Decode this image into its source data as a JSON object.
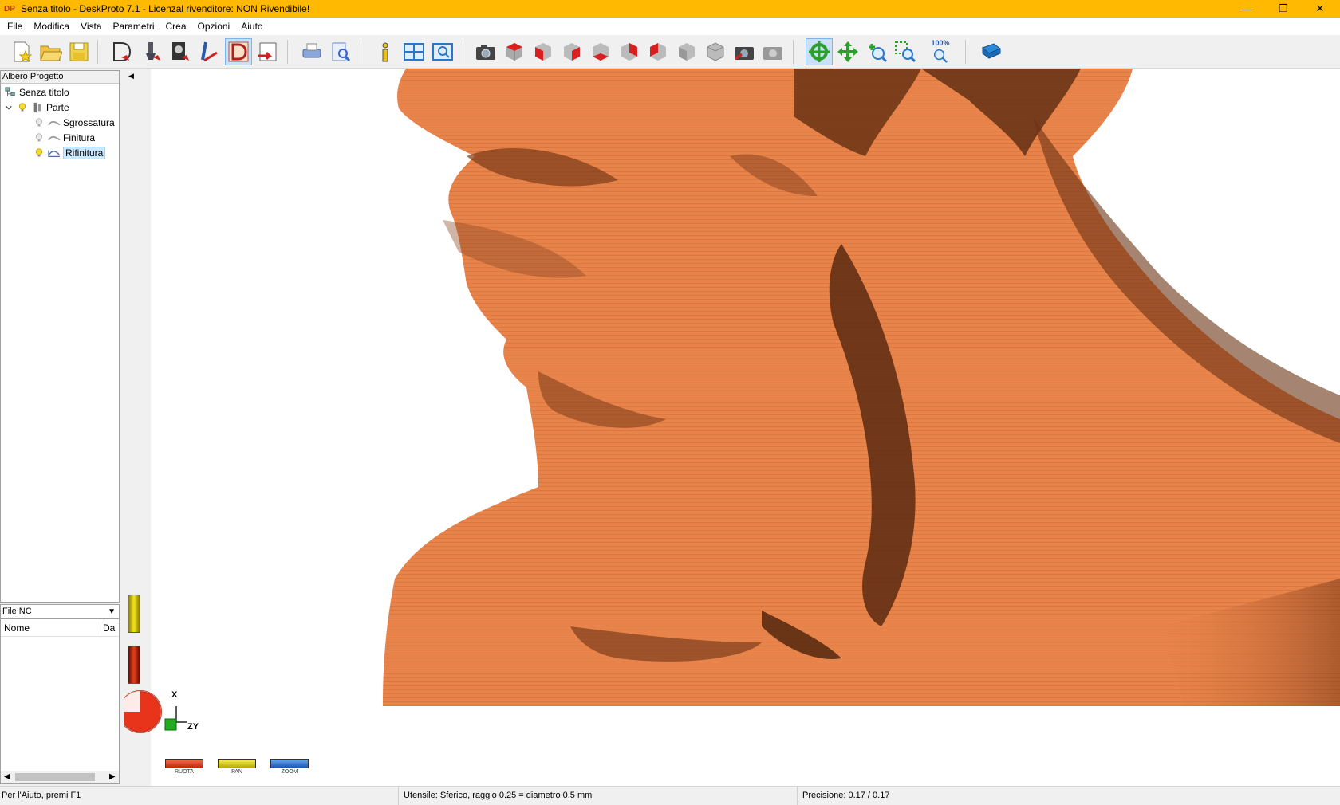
{
  "window": {
    "title": "Senza titolo - DeskProto 7.1 - Licenzal rivenditore: NON Rivendibile!",
    "app_icon": "DP",
    "controls": {
      "minimize": "—",
      "restore": "❐",
      "close": "✕"
    }
  },
  "menu": [
    "File",
    "Modifica",
    "Vista",
    "Parametri",
    "Crea",
    "Opzioni",
    "Aiuto"
  ],
  "toolbar": {
    "zoom_100_label": "100%",
    "buttons": [
      "new-file-icon",
      "open-folder-icon",
      "save-disk-icon",
      "part-params-icon",
      "operation-params-icon",
      "geometry-params-icon",
      "tool-params-icon",
      "deskproto-d-icon",
      "write-nc-icon",
      "print-icon",
      "print-preview-icon",
      "info-icon",
      "tile-view-icon",
      "view-zoom-icon",
      "camera-icon",
      "view-iso-icon",
      "view-front-icon",
      "view-right-icon",
      "view-top-icon",
      "view-back-icon",
      "view-left-icon",
      "view-bottom-icon",
      "view-gray-icon",
      "camera-red-icon",
      "camera-gray-icon",
      "rotate-icon",
      "pan-icon",
      "zoom-icon",
      "zoom-window-icon",
      "zoom-100-icon",
      "book-icon"
    ]
  },
  "tree": {
    "header": "Albero Progetto",
    "root": "Senza titolo",
    "part": "Parte",
    "operations": [
      "Sgrossatura",
      "Finitura",
      "Rifinitura"
    ],
    "selected": "Rifinitura"
  },
  "nc_panel": {
    "selector": "File NC",
    "columns": [
      "Nome",
      "Da"
    ]
  },
  "viewport": {
    "model_color": "#e8834a",
    "shadow_color": "#5a2a10",
    "axes": {
      "x": "X",
      "zy": "ZY"
    },
    "mode_buttons": [
      {
        "label": "RUOTA",
        "color": "#e04a2a"
      },
      {
        "label": "PAN",
        "color": "#e8d400"
      },
      {
        "label": "ZOOM",
        "color": "#2a78d4"
      }
    ]
  },
  "status": {
    "help": "Per l'Aiuto, premi F1",
    "tool": "Utensile: Sferico, raggio 0.25 = diametro 0.5 mm",
    "precision": "Precisione: 0.17 / 0.17"
  }
}
